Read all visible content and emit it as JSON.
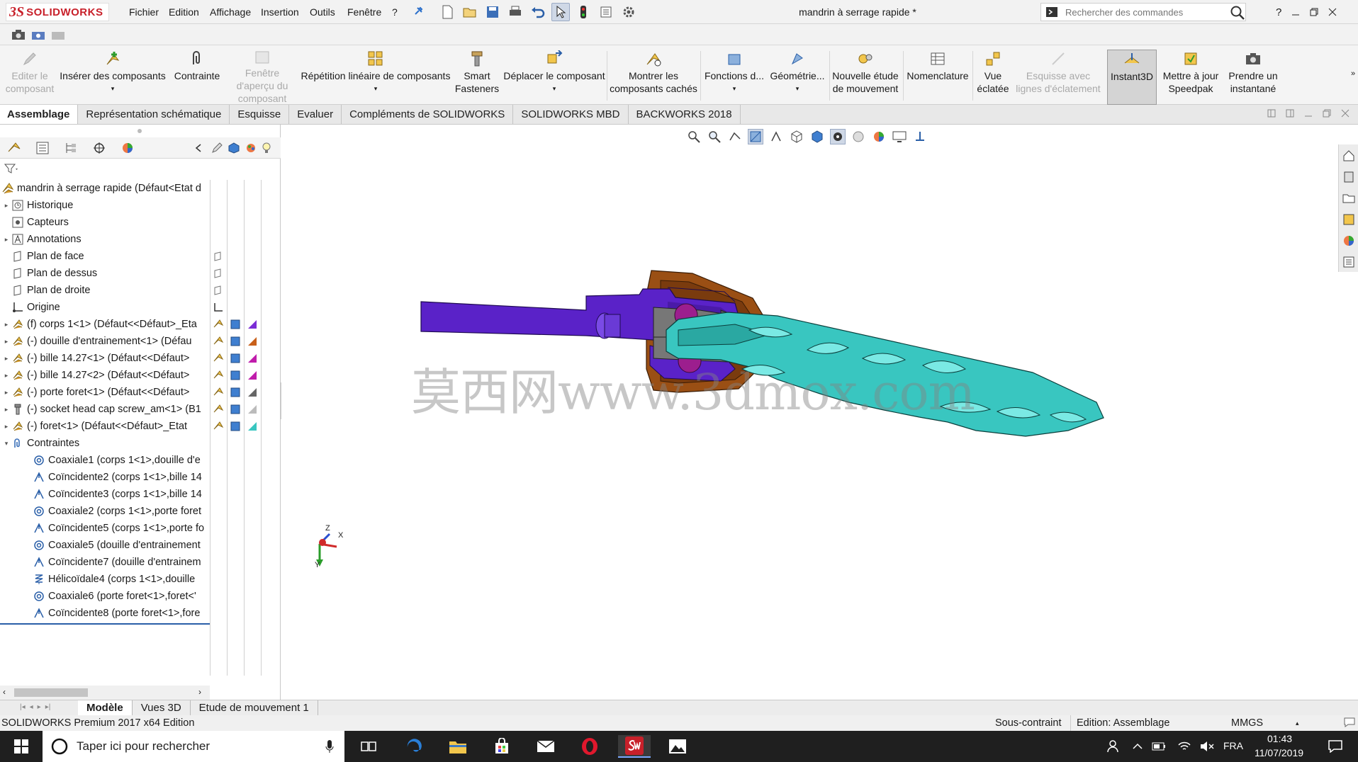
{
  "app": {
    "brand_prefix": "3S",
    "brand": "SOLIDWORKS",
    "document_title": "mandrin à serrage rapide *"
  },
  "menu": [
    "Fichier",
    "Edition",
    "Affichage",
    "Insertion",
    "Outils",
    "Fenêtre",
    "?"
  ],
  "search": {
    "placeholder": "Rechercher des commandes"
  },
  "toolbar": [
    {
      "label": "Editer le composant",
      "disabled": true
    },
    {
      "label": "Insérer des composants",
      "disabled": false
    },
    {
      "label": "Contrainte",
      "disabled": false
    },
    {
      "label": "Fenêtre d'aperçu du composant",
      "disabled": true
    },
    {
      "label": "Répétition linéaire de composants",
      "disabled": false
    },
    {
      "label": "Smart Fasteners",
      "disabled": false
    },
    {
      "label": "Déplacer le composant",
      "disabled": false
    },
    {
      "label": "Montrer les composants cachés",
      "disabled": false
    },
    {
      "label": "Fonctions d...",
      "disabled": false
    },
    {
      "label": "Géométrie...",
      "disabled": false
    },
    {
      "label": "Nouvelle étude de mouvement",
      "disabled": false
    },
    {
      "label": "Nomenclature",
      "disabled": false
    },
    {
      "label": "Vue éclatée",
      "disabled": false
    },
    {
      "label": "Esquisse avec lignes d'éclatement",
      "disabled": true
    },
    {
      "label": "Instant3D",
      "active": true
    },
    {
      "label": "Mettre à jour Speedpak",
      "disabled": false
    },
    {
      "label": "Prendre un instantané",
      "disabled": false
    }
  ],
  "tabs": [
    "Assemblage",
    "Représentation schématique",
    "Esquisse",
    "Evaluer",
    "Compléments de SOLIDWORKS",
    "SOLIDWORKS MBD",
    "BACKWORKS 2018"
  ],
  "active_tab": "Assemblage",
  "tree": {
    "root": "mandrin à serrage rapide  (Défaut<Etat d",
    "items": [
      {
        "label": "Historique",
        "icon": "history-folder-icon",
        "expand": true
      },
      {
        "label": "Capteurs",
        "icon": "sensor-icon",
        "expand": false
      },
      {
        "label": "Annotations",
        "icon": "annotations-icon",
        "expand": true
      },
      {
        "label": "Plan de face",
        "icon": "plane-icon",
        "expand": false
      },
      {
        "label": "Plan de dessus",
        "icon": "plane-icon",
        "expand": false
      },
      {
        "label": "Plan de droite",
        "icon": "plane-icon",
        "expand": false
      },
      {
        "label": "Origine",
        "icon": "origin-icon",
        "expand": false
      },
      {
        "label": "(f) corps 1<1> (Défaut<<Défaut>_Eta",
        "icon": "part-icon",
        "expand": true
      },
      {
        "label": "(-) douille d'entrainement<1> (Défau",
        "icon": "part-icon",
        "expand": true
      },
      {
        "label": "(-) bille 14.27<1> (Défaut<<Défaut>",
        "icon": "part-icon",
        "expand": true
      },
      {
        "label": "(-) bille 14.27<2> (Défaut<<Défaut>",
        "icon": "part-icon",
        "expand": true
      },
      {
        "label": "(-) porte foret<1> (Défaut<<Défaut>",
        "icon": "part-icon",
        "expand": true
      },
      {
        "label": "(-) socket head cap screw_am<1> (B1",
        "icon": "screw-icon",
        "expand": true
      },
      {
        "label": "(-) foret<1> (Défaut<<Défaut>_Etat",
        "icon": "part-icon",
        "expand": true
      },
      {
        "label": "Contraintes",
        "icon": "mates-icon",
        "expand": true
      }
    ],
    "mates": [
      {
        "label": "Coaxiale1 (corps 1<1>,douille d'e",
        "type": "concentric"
      },
      {
        "label": "Coïncidente2 (corps 1<1>,bille 14",
        "type": "coincident"
      },
      {
        "label": "Coïncidente3 (corps 1<1>,bille 14",
        "type": "coincident"
      },
      {
        "label": "Coaxiale2 (corps 1<1>,porte foret",
        "type": "concentric"
      },
      {
        "label": "Coïncidente5 (corps 1<1>,porte fo",
        "type": "coincident"
      },
      {
        "label": "Coaxiale5 (douille d'entrainement",
        "type": "concentric"
      },
      {
        "label": "Coïncidente7 (douille d'entrainem",
        "type": "coincident"
      },
      {
        "label": "Hélicoïdale4 (corps 1<1>,douille",
        "type": "helical"
      },
      {
        "label": "Coaxiale6 (porte foret<1>,foret<'",
        "type": "concentric"
      },
      {
        "label": "Coïncidente8 (porte foret<1>,fore",
        "type": "coincident"
      }
    ]
  },
  "watermark": "莫西网www.3dmox.com",
  "triad": {
    "x": "X",
    "y": "Y",
    "z": "Z"
  },
  "bottom_tabs": [
    "Modèle",
    "Vues 3D",
    "Etude de mouvement 1"
  ],
  "status": {
    "edition": "SOLIDWORKS Premium 2017 x64 Edition",
    "constraint": "Sous-contraint",
    "mode": "Edition: Assemblage",
    "units": "MMGS"
  },
  "taskbar": {
    "search_placeholder": "Taper ici pour rechercher",
    "lang": "FRA",
    "time": "01:43",
    "date": "11/07/2019"
  },
  "colors": {
    "accent": "#c8202a",
    "body": "#5a22c8",
    "sleeve": "#9a4f14",
    "drill": "#39c6c0",
    "ball": "#9c1e8e"
  }
}
